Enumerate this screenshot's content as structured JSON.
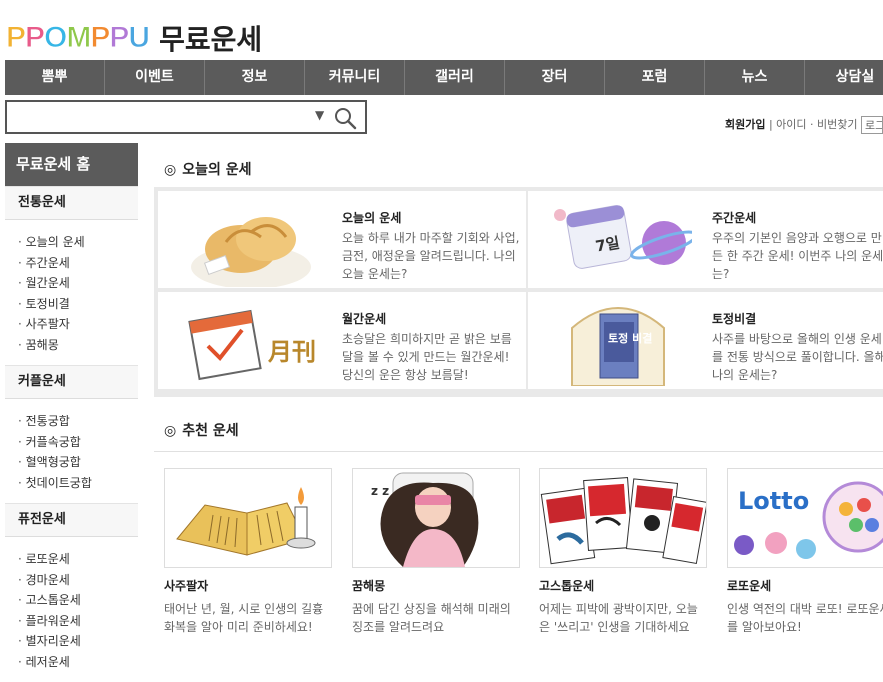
{
  "logo": {
    "brand": "PPOMPPU",
    "title": "무료운세"
  },
  "gnb": [
    "뽐뿌",
    "이벤트",
    "정보",
    "커뮤니티",
    "갤러리",
    "장터",
    "포럼",
    "뉴스",
    "상담실"
  ],
  "search": {
    "value": "",
    "dropdown": "▼"
  },
  "member": {
    "join": "회원가입",
    "sep": "|",
    "find": "아이디 · 비번찾기",
    "login": "로그"
  },
  "sidebar": {
    "home": "무료운세 홈",
    "groups": [
      {
        "title": "전통운세",
        "items": [
          "오늘의 운세",
          "주간운세",
          "월간운세",
          "토정비결",
          "사주팔자",
          "꿈해몽"
        ]
      },
      {
        "title": "커플운세",
        "items": [
          "전통궁합",
          "커플속궁합",
          "혈액형궁합",
          "첫데이트궁합"
        ]
      },
      {
        "title": "퓨전운세",
        "items": [
          "로또운세",
          "경마운세",
          "고스톱운세",
          "플라워운세",
          "별자리운세",
          "레저운세"
        ]
      }
    ]
  },
  "today": {
    "mark": "◎",
    "title": "오늘의 운세",
    "cards": [
      {
        "title": "오늘의 운세",
        "desc": "오늘 하루 내가 마주할 기회와 사업, 금전, 애정운을 알려드립니다. 나의 오늘 운세는?"
      },
      {
        "title": "주간운세",
        "desc": "우주의 기본인 음양과 오행으로 만든 한 주간 운세! 이번주 나의 운세는?",
        "calendar_day": "7일"
      },
      {
        "title": "월간운세",
        "desc": "초승달은 희미하지만 곧 밝은 보름달을 볼 수 있게 만드는 월간운세! 당신의 운은 항상 보름달!",
        "img_text": "月刊"
      },
      {
        "title": "토정비결",
        "desc": "사주를 바탕으로 올해의 인생 운세를 전통 방식으로 풀이합니다. 올해 나의 운세는?",
        "img_text": "토정 비결"
      }
    ]
  },
  "recommend": {
    "mark": "◎",
    "title": "추천 운세",
    "cards": [
      {
        "title": "사주팔자",
        "desc": "태어난 년, 월, 시로 인생의 길흉화복을 알아 미리 준비하세요!"
      },
      {
        "title": "꿈해몽",
        "desc": "꿈에 담긴 상징을 해석해 미래의 징조를 알려드려요"
      },
      {
        "title": "고스톱운세",
        "desc": "어제는 피박에 광박이지만, 오늘은 '쓰리고' 인생을 기대하세요"
      },
      {
        "title": "로또운세",
        "desc": "인생 역전의 대박 로또! 로또운세를 알아보아요!",
        "img_text": "Lotto"
      }
    ]
  }
}
